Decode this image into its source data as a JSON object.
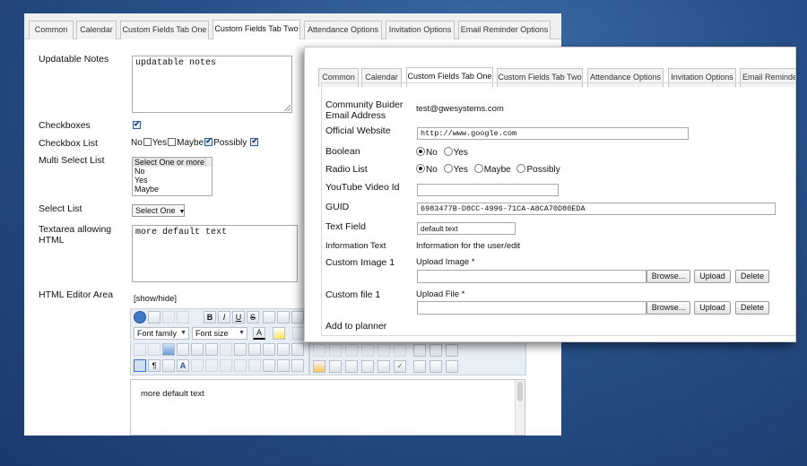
{
  "back_form": {
    "tabs": [
      "Common",
      "Calendar",
      "Custom Fields Tab One",
      "Custom Fields Tab Two",
      "Attendance Options",
      "Invitation Options",
      "Email Reminder Options"
    ],
    "active_tab": "Custom Fields Tab Two",
    "updatable_notes": {
      "label": "Updatable Notes",
      "value": "updatable notes"
    },
    "checkboxes": {
      "label": "Checkboxes",
      "checked": true
    },
    "checkbox_list": {
      "label": "Checkbox List",
      "options": [
        {
          "label": "No",
          "checked": false,
          "box": false
        },
        {
          "label": "Yes",
          "checked": false,
          "box": true
        },
        {
          "label": "Maybe",
          "checked": false,
          "box": true
        },
        {
          "label": "Possibly",
          "checked": true,
          "box": true
        }
      ],
      "trailing_checked": true
    },
    "multi_select": {
      "label": "Multi Select List",
      "options": [
        "Select One or more",
        "No",
        "Yes",
        "Maybe"
      ]
    },
    "select_list": {
      "label": "Select List",
      "selected": "Select One"
    },
    "textarea_html": {
      "label": "Textarea allowing HTML",
      "value": "more default text"
    },
    "html_editor": {
      "label": "HTML Editor Area",
      "toggle": "[show/hide]",
      "font_family": "Font family",
      "font_size": "Font size",
      "content": "more default text",
      "toolbar_text_buttons": [
        "B",
        "I",
        "U",
        "S"
      ]
    }
  },
  "front_form": {
    "tabs": [
      "Common",
      "Calendar",
      "Custom Fields Tab One",
      "Custom Fields Tab Two",
      "Attendance Options",
      "Invitation Options",
      "Email Reminder"
    ],
    "active_tab": "Custom Fields Tab One",
    "rows": {
      "community_builder_email": {
        "label": "Community Buider Email Address",
        "value": "test@gwesystems.com"
      },
      "official_website": {
        "label": "Official Website",
        "value": "http://www.google.com"
      },
      "boolean": {
        "label": "Boolean",
        "options": [
          "No",
          "Yes"
        ],
        "selected": "No"
      },
      "radio_list": {
        "label": "Radio List",
        "options": [
          "No",
          "Yes",
          "Maybe",
          "Possibly"
        ],
        "selected": "No"
      },
      "youtube_video_id": {
        "label": "YouTube Video Id",
        "value": ""
      },
      "guid": {
        "label": "GUID",
        "value": "6983477B-D8CC-4996-71CA-A8CA70D80EDA"
      },
      "text_field": {
        "label": "Text Field",
        "value": "default text"
      },
      "information_text": {
        "label": "Information Text",
        "value": "Information for the user/edit"
      },
      "custom_image_1": {
        "label": "Custom Image 1",
        "upload_label": "Upload Image *"
      },
      "custom_file_1": {
        "label": "Custom file 1",
        "upload_label": "Upload File *"
      },
      "add_to_planner": {
        "label": "Add to planner"
      }
    },
    "buttons": {
      "browse": "Browse...",
      "upload": "Upload",
      "delete": "Delete"
    }
  }
}
